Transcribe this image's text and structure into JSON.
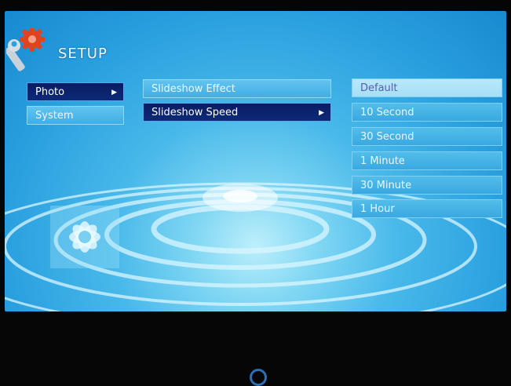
{
  "header": {
    "title": "SETUP"
  },
  "categories": [
    {
      "label": "Photo",
      "selected": true,
      "has_submenu": true
    },
    {
      "label": "System",
      "selected": false,
      "has_submenu": false
    }
  ],
  "photo_menu": [
    {
      "label": "Slideshow Effect",
      "selected": false,
      "has_submenu": false
    },
    {
      "label": "Slideshow Speed",
      "selected": true,
      "has_submenu": true
    }
  ],
  "speed_options": [
    {
      "label": "Default",
      "active": true
    },
    {
      "label": "10 Second",
      "active": false
    },
    {
      "label": "30 Second",
      "active": false
    },
    {
      "label": "1 Minute",
      "active": false
    },
    {
      "label": "30 Minute",
      "active": false
    },
    {
      "label": "1 Hour",
      "active": false
    }
  ],
  "icons": {
    "header_icon": "wrench-gear-icon",
    "submenu_arrow": "arrow-right-icon",
    "decoration": "flower-icon",
    "power": "power-led-icon"
  },
  "colors": {
    "selected_bg": "#0a1c63",
    "background": "#2aa0df",
    "active_option_text": "#5d5ab2"
  }
}
